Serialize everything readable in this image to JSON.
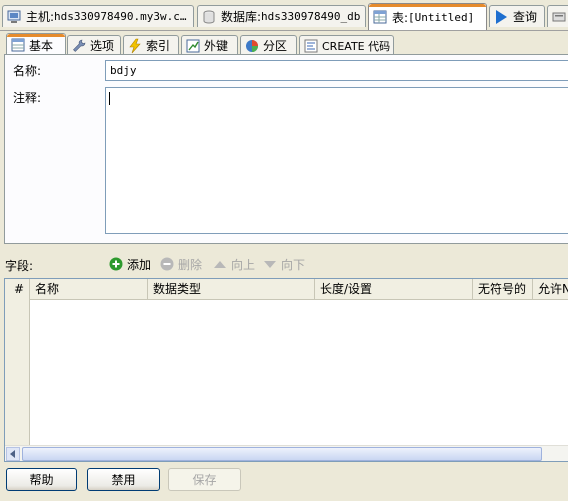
{
  "top_tabs": [
    {
      "prefix": "主机: ",
      "value": "hds330978490.my3w.c…",
      "icon": "host-icon"
    },
    {
      "prefix": "数据库: ",
      "value": "hds330978490_db",
      "icon": "database-icon"
    },
    {
      "prefix": "表: ",
      "value": "[Untitled]",
      "icon": "table-icon"
    },
    {
      "prefix": "",
      "value": "查询",
      "icon": "query-run-icon"
    }
  ],
  "inner_tabs": [
    {
      "label": "基本",
      "icon": "table-basic-icon"
    },
    {
      "label": "选项",
      "icon": "wrench-icon"
    },
    {
      "label": "索引",
      "icon": "lightning-icon"
    },
    {
      "label": "外键",
      "icon": "foreign-key-icon"
    },
    {
      "label": "分区",
      "icon": "partition-icon"
    },
    {
      "label": "CREATE 代码",
      "icon": "code-icon"
    }
  ],
  "form": {
    "name_label": "名称:",
    "name_value": "bdjy",
    "comment_label": "注释:",
    "comment_value": ""
  },
  "fields_toolbar": {
    "label": "字段:",
    "add": "添加",
    "delete": "删除",
    "up": "向上",
    "down": "向下"
  },
  "grid": {
    "columns": [
      "#",
      "名称",
      "数据类型",
      "长度/设置",
      "无符号的",
      "允许N"
    ],
    "rows": []
  },
  "buttons": {
    "help": "帮助",
    "discard": "禁用",
    "save": "保存"
  },
  "colors": {
    "active_tab_accent": "#e68b2c",
    "add_icon": "#2e9a2e",
    "query_arrow": "#1f6fcf"
  }
}
